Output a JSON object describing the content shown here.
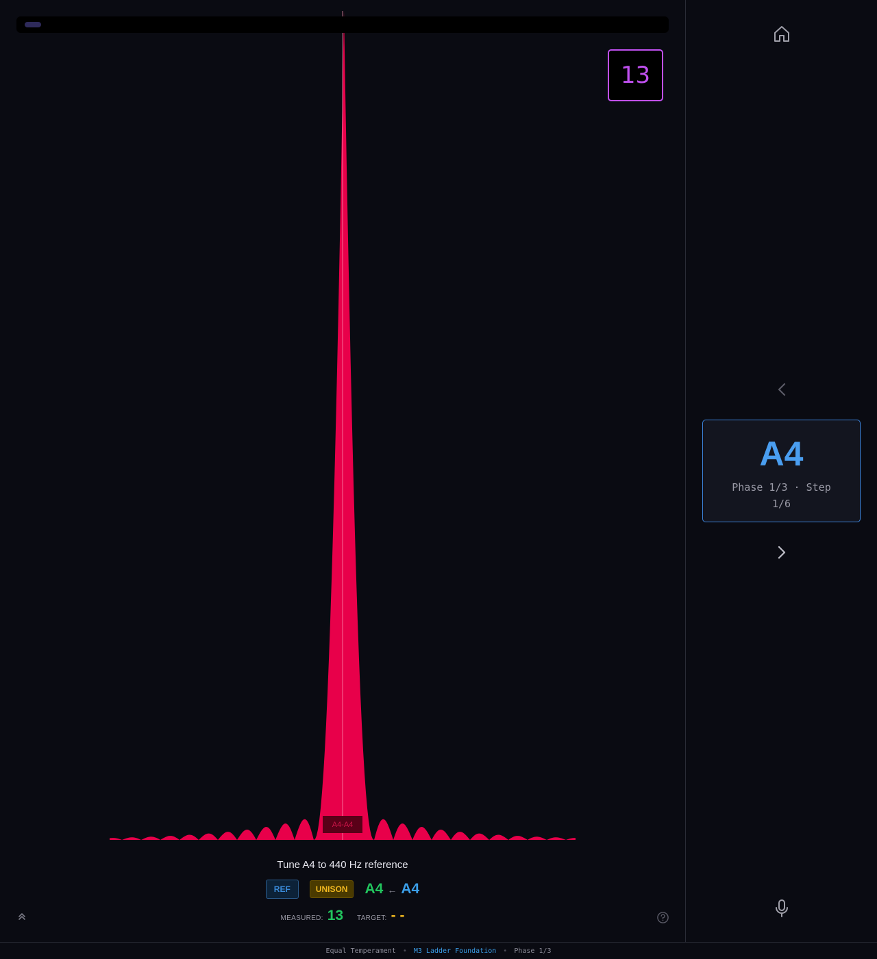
{
  "colors": {
    "background": "#0a0b12",
    "peak": "#e8004a",
    "accent_blue": "#3b9ee8",
    "accent_green": "#22c55e",
    "accent_yellow": "#f0b820",
    "accent_purple": "#c050f0"
  },
  "counter": {
    "value": "13"
  },
  "chart_data": {
    "type": "area",
    "series_color": "#e8004a",
    "peak_label": "A4-A4",
    "marker_line": true
  },
  "instruction": "Tune A4 to 440 Hz reference",
  "badges": {
    "ref": "REF",
    "unison": "UNISON"
  },
  "interval": {
    "from_note": "A4",
    "arrow": "←",
    "to_note": "A4"
  },
  "readout": {
    "measured_label": "MEASURED:",
    "measured_value": "13",
    "target_label": "TARGET:",
    "target_value": "- -"
  },
  "sidebar": {
    "home_icon": "home-icon",
    "prev_icon": "chevron-left-icon",
    "next_icon": "chevron-right-icon",
    "mic_icon": "microphone-icon",
    "current_note": "A4",
    "phase_step": "Phase 1/3 · Step 1/6"
  },
  "footer": {
    "temperament": "Equal Temperament",
    "sep1": "•",
    "sequence": "M3 Ladder Foundation",
    "sep2": "•",
    "phase": "Phase 1/3"
  }
}
